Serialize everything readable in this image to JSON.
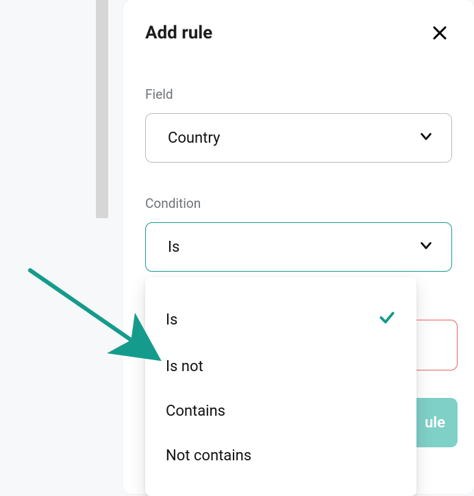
{
  "panel": {
    "title": "Add rule",
    "field_label": "Field",
    "field_value": "Country",
    "condition_label": "Condition",
    "condition_value": "Is"
  },
  "options": [
    "Is",
    "Is not",
    "Contains",
    "Not contains"
  ],
  "selected_index": 0,
  "buttons": {
    "add_visible_fragment": "ule"
  },
  "icons": {
    "close": "close-icon",
    "chevron": "chevron-down-icon",
    "check": "check-icon"
  },
  "colors": {
    "accent": "#159b8b",
    "accent_faded": "#7fd0c7",
    "danger": "#ec5f5a",
    "muted": "#6c7275",
    "border": "#b7bcbf"
  }
}
